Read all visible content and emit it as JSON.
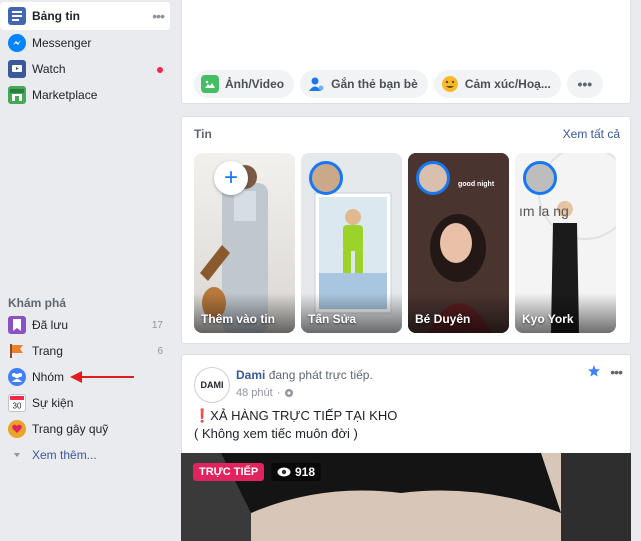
{
  "sidebar": {
    "items": [
      {
        "label": "Bảng tin",
        "icon": "news-feed-icon"
      },
      {
        "label": "Messenger",
        "icon": "messenger-icon"
      },
      {
        "label": "Watch",
        "icon": "watch-icon"
      },
      {
        "label": "Marketplace",
        "icon": "marketplace-icon"
      }
    ],
    "explore_title": "Khám phá",
    "explore": [
      {
        "label": "Đã lưu",
        "count": "17",
        "icon": "saved-icon"
      },
      {
        "label": "Trang",
        "count": "6",
        "icon": "pages-flag-icon"
      },
      {
        "label": "Nhóm",
        "icon": "groups-icon"
      },
      {
        "label": "Sự kiện",
        "icon": "events-calendar-icon"
      },
      {
        "label": "Trang gây quỹ",
        "icon": "fundraiser-icon"
      }
    ],
    "see_more": "Xem thêm..."
  },
  "composer": {
    "actions": [
      {
        "label": "Ảnh/Video",
        "icon": "photo-video-icon"
      },
      {
        "label": "Gắn thẻ bạn bè",
        "icon": "tag-friends-icon"
      },
      {
        "label": "Cảm xúc/Hoạ...",
        "icon": "feeling-emoji-icon"
      }
    ]
  },
  "stories": {
    "title": "Tin",
    "see_all": "Xem tất cả",
    "items": [
      {
        "name": "Thêm vào tin"
      },
      {
        "name": "Tấn Sửa"
      },
      {
        "name": "Bé Duyên"
      },
      {
        "name": "Kyo York"
      }
    ],
    "overlay_text": [
      "good night",
      "ım la ng"
    ]
  },
  "post": {
    "avatar_text": "DAMI",
    "author": "Dami",
    "action": "đang phát trực tiếp.",
    "time": "48 phút",
    "line1": "❗XẢ HÀNG TRỰC TIẾP TẠI KHO",
    "line2": "( Không xem tiếc muôn đời )",
    "live_label": "TRỰC TIẾP",
    "viewers": "918"
  },
  "colors": {
    "accent": "#1877f2",
    "link": "#385898",
    "live": "#e0245e",
    "notification": "#f02849",
    "background": "#e9ebee"
  }
}
